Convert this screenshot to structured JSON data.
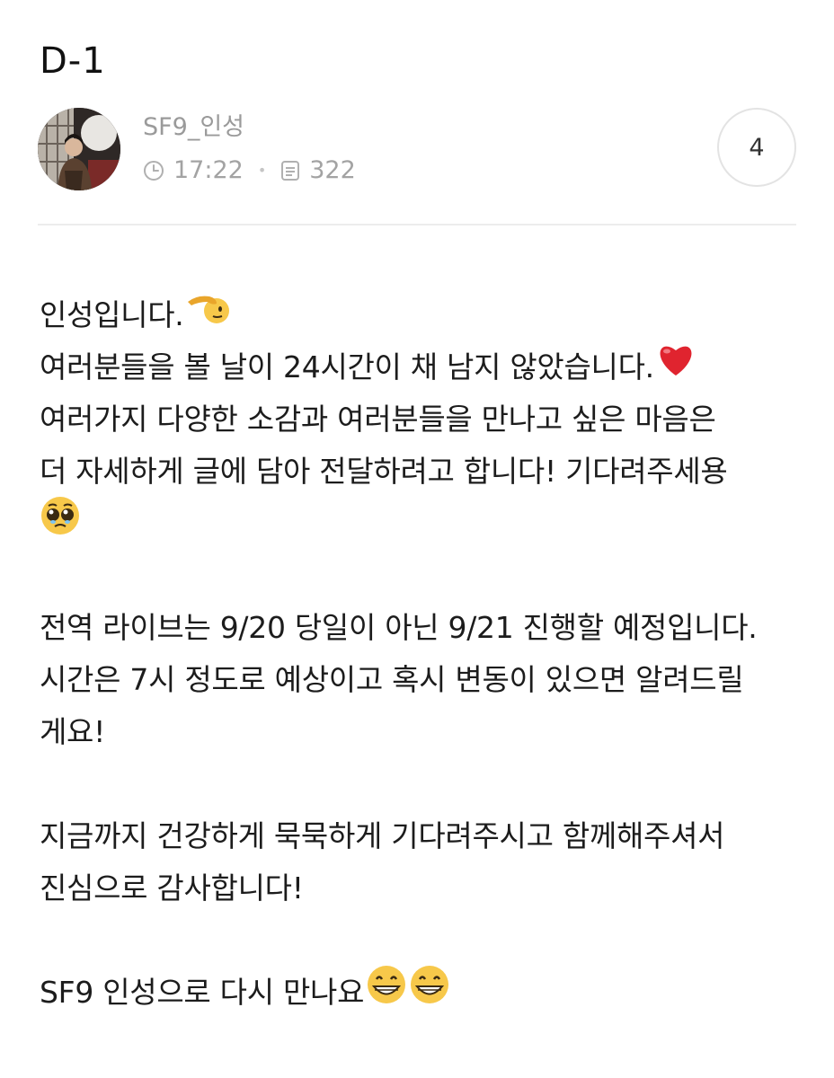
{
  "post": {
    "title": "D-1",
    "author": "SF9_인성",
    "time": "17:22",
    "views": "322",
    "count": "4"
  },
  "body": {
    "line1": "인성입니다.",
    "line2": "여러분들을 볼 날이 24시간이 채 남지 않았습니다.",
    "line3": "여러가지 다양한 소감과 여러분들을 만나고 싶은 마음은",
    "line4": "더 자세하게 글에 담아 전달하려고 합니다! 기다려주세용",
    "line6": "전역 라이브는 9/20 당일이 아닌 9/21 진행할 예정입니다.",
    "line7": "시간은 7시 정도로 예상이고 혹시 변동이 있으면 알려드릴",
    "line8": "게요!",
    "line10": "지금까지 건강하게 묵묵하게 기다려주시고 함께해주셔서",
    "line11": "진심으로 감사합니다!",
    "line13": "SF9 인성으로 다시 만나요"
  },
  "icons": {
    "time": "clock-icon",
    "views": "document-icon",
    "emoji_salute": "salute-face-emoji",
    "emoji_heart": "red-heart-emoji",
    "emoji_pleading": "pleading-face-emoji",
    "emoji_grin": "grinning-face-emoji"
  },
  "colors": {
    "meta_text": "#a3a3a3",
    "heart": "#e0242f",
    "emoji_yellow": "#f7c84a"
  }
}
